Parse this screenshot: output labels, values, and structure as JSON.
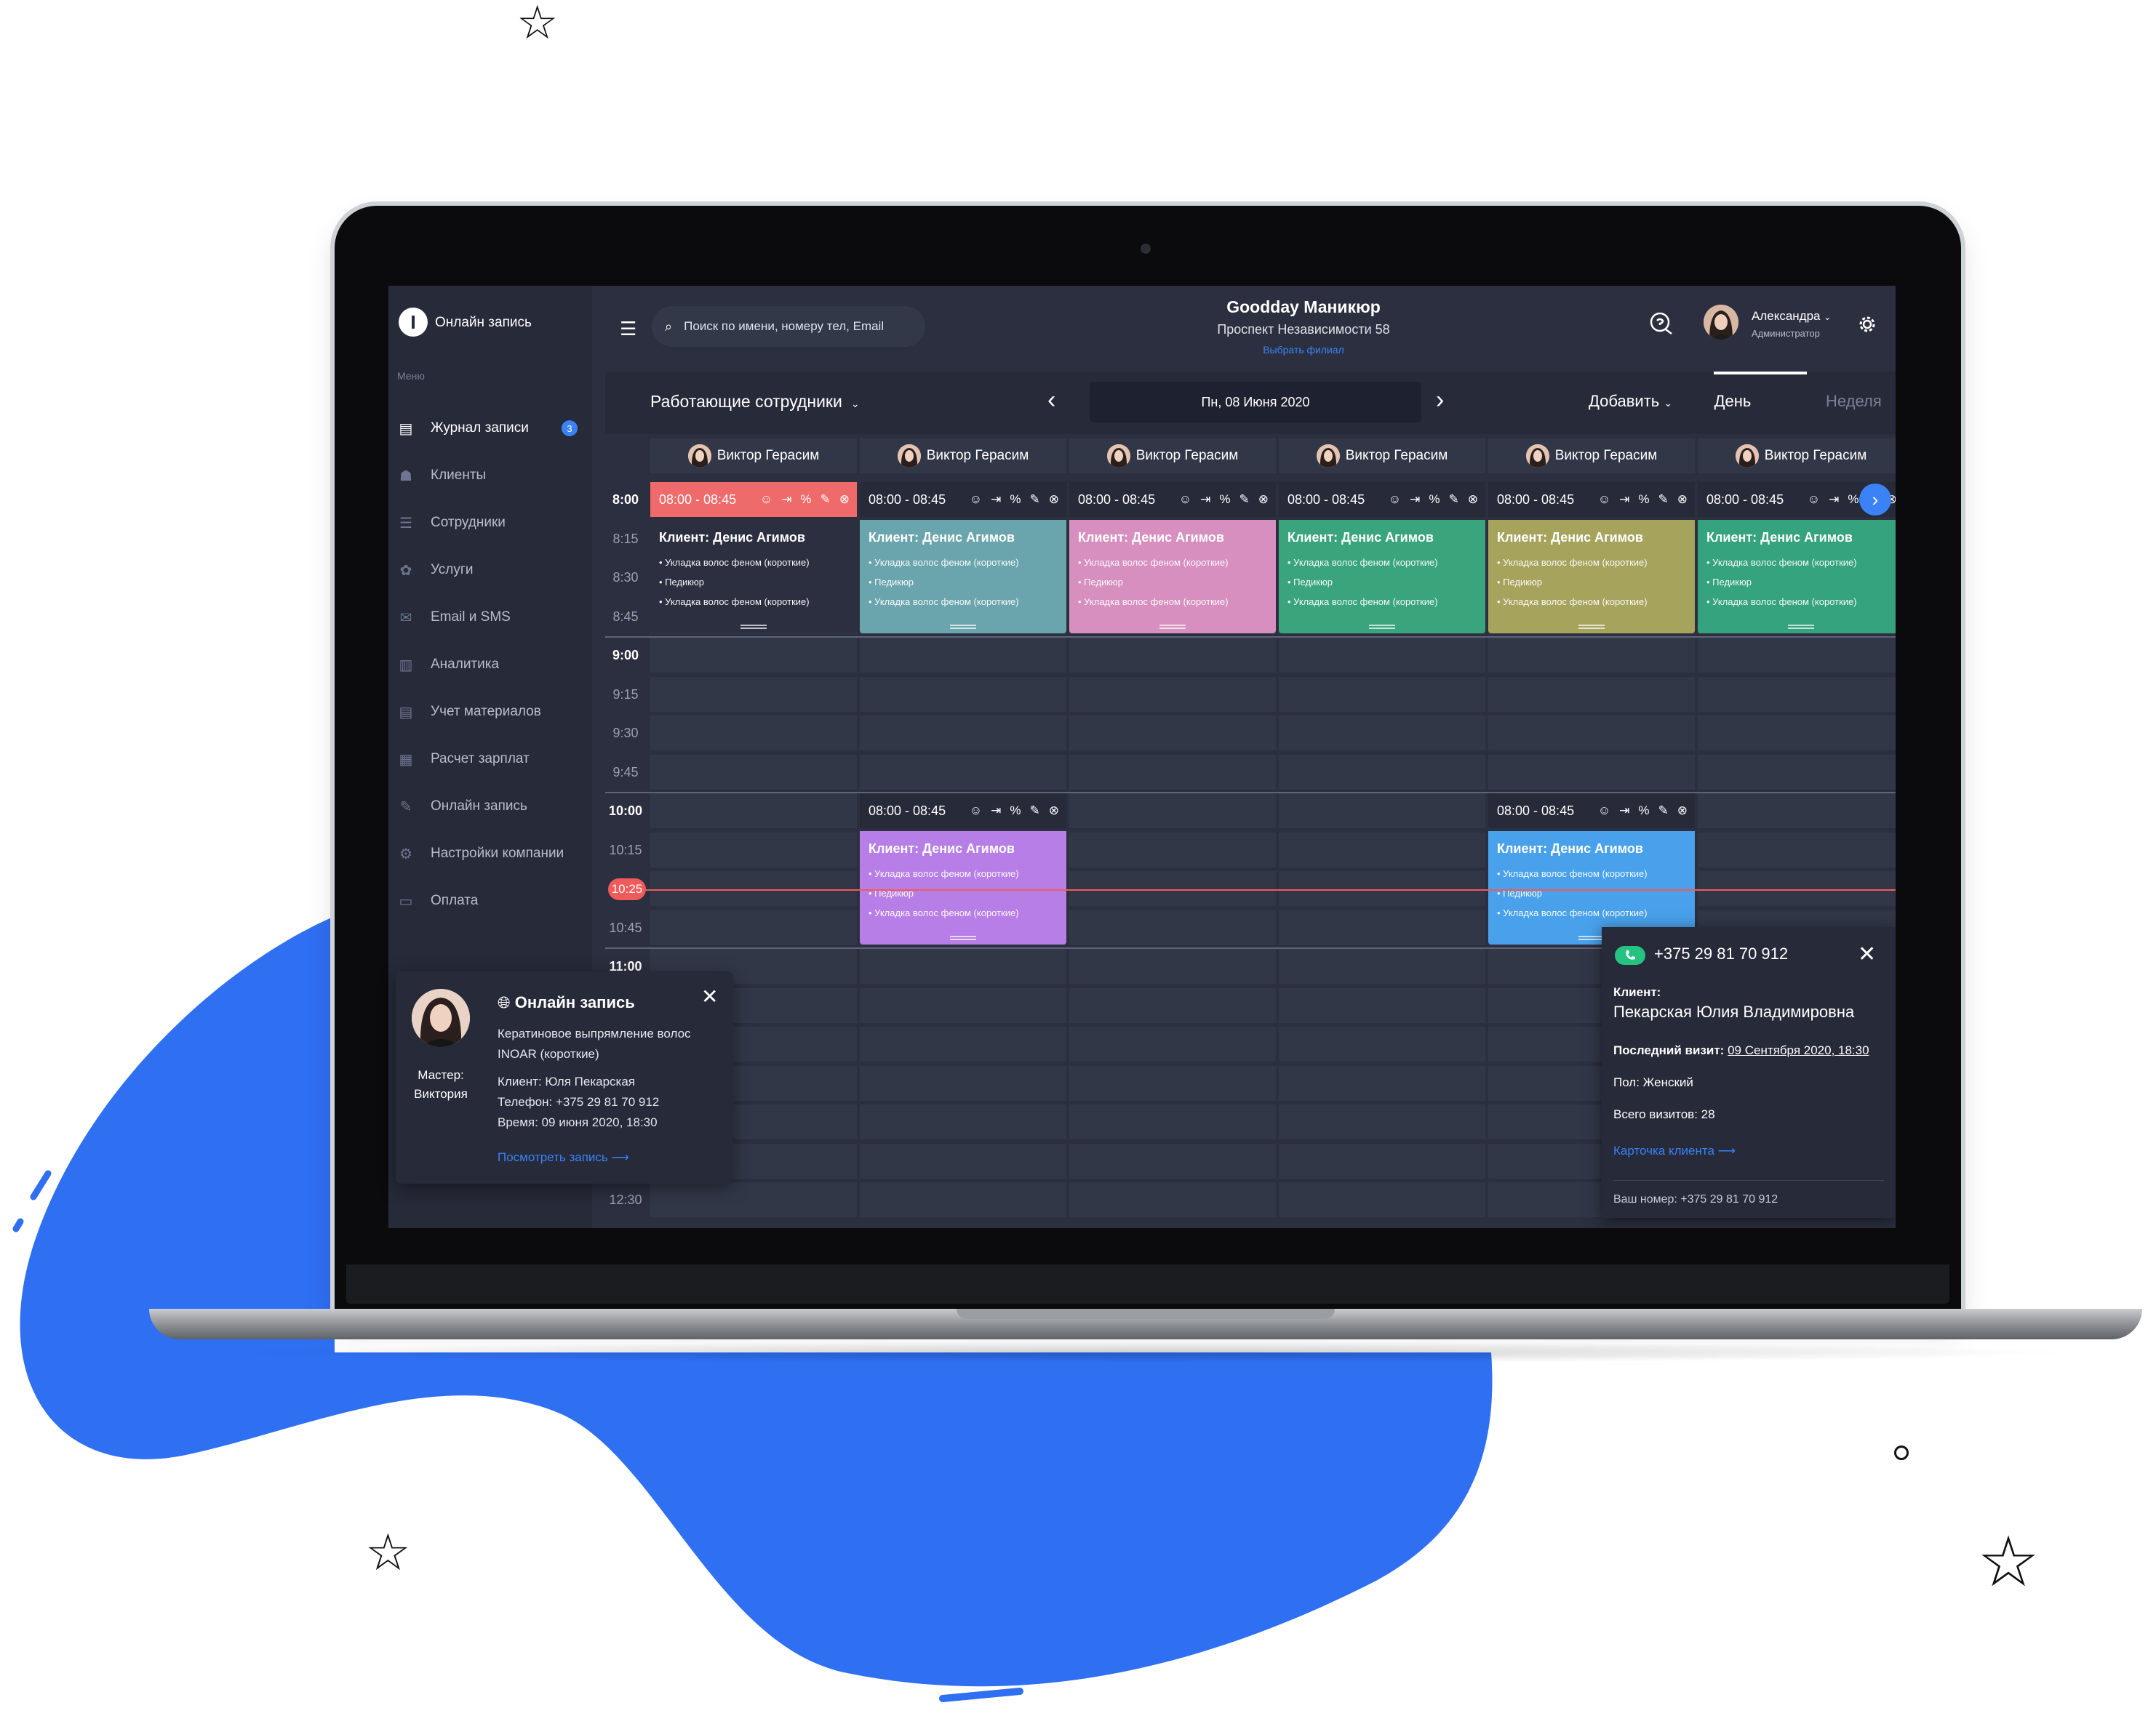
{
  "colors": {
    "accent": "#3b82f6",
    "blob": "#2f6ff2",
    "sidebar": "#262a39",
    "content": "#2b2f3f",
    "slot": "#323748",
    "now": "#ef5b5b",
    "success": "#26c281"
  },
  "app": {
    "logo_text": "Онлайн запись",
    "menu_title": "Меню"
  },
  "sidebar": {
    "items": [
      {
        "label": "Журнал записи",
        "icon": "book-icon",
        "badge": "3"
      },
      {
        "label": "Клиенты",
        "icon": "clients-icon"
      },
      {
        "label": "Сотрудники",
        "icon": "staff-icon"
      },
      {
        "label": "Услуги",
        "icon": "services-icon"
      },
      {
        "label": "Email и SMS",
        "icon": "mail-icon"
      },
      {
        "label": "Аналитика",
        "icon": "chart-icon"
      },
      {
        "label": "Учет материалов",
        "icon": "materials-icon"
      },
      {
        "label": "Расчет зарплат",
        "icon": "salary-icon"
      },
      {
        "label": "Онлайн запись",
        "icon": "online-booking-icon"
      },
      {
        "label": "Настройки компании",
        "icon": "gear-icon"
      },
      {
        "label": "Оплата",
        "icon": "payment-icon"
      }
    ]
  },
  "header": {
    "search_placeholder": "Поиск по имени, номеру тел, Email",
    "title": "Goodday Маникюр",
    "address": "Проспект Независимости 58",
    "branch_link": "Выбрать филиал",
    "user_name": "Александра",
    "user_role": "Администратор"
  },
  "toolbar": {
    "filter": "Работающие сотрудники",
    "date": "Пн, 08 Июня 2020",
    "add": "Добавить",
    "view_day": "День",
    "view_week": "Неделя"
  },
  "staff": [
    "Виктор Герасим",
    "Виктор Герасим",
    "Виктор Герасим",
    "Виктор Герасим",
    "Виктор Герасим",
    "Виктор Герасим"
  ],
  "times": [
    {
      "label": "8:00",
      "hour": true
    },
    {
      "label": "8:15"
    },
    {
      "label": "8:30"
    },
    {
      "label": "8:45"
    },
    {
      "label": "9:00",
      "hour": true
    },
    {
      "label": "9:15"
    },
    {
      "label": "9:30"
    },
    {
      "label": "9:45"
    },
    {
      "label": "10:00",
      "hour": true
    },
    {
      "label": "10:15"
    },
    {
      "label": ""
    },
    {
      "label": "10:45"
    },
    {
      "label": "11:00",
      "hour": true
    },
    {
      "label": ""
    },
    {
      "label": ""
    },
    {
      "label": ""
    },
    {
      "label": ""
    },
    {
      "label": ""
    },
    {
      "label": "12:30"
    }
  ],
  "current_time": "10:25",
  "appointment": {
    "time": "08:00 - 08:45",
    "client": "Клиент: Денис Агимов",
    "services": [
      "• Укладка волос феном (короткие)",
      "• Педикюр",
      "• Укладка волос феном (короткие)"
    ]
  },
  "appointments": [
    {
      "col": 0,
      "row": 0,
      "color": "#6f9fd8",
      "head_color": "#ef6a6a",
      "body_color": "#2b2f3f"
    },
    {
      "col": 1,
      "row": 0,
      "color": "#6aa4ad"
    },
    {
      "col": 2,
      "row": 0,
      "color": "#d68fbf"
    },
    {
      "col": 3,
      "row": 0,
      "color": "#3aa57c"
    },
    {
      "col": 4,
      "row": 0,
      "color": "#a6a35c"
    },
    {
      "col": 5,
      "row": 0,
      "color": "#35a37d"
    },
    {
      "col": 1,
      "row": 8,
      "color": "#b67ee6"
    },
    {
      "col": 4,
      "row": 8,
      "color": "#48a1ea"
    }
  ],
  "client_popup": {
    "phone": "+375 29 81 70 912",
    "client_label": "Клиент:",
    "client_name": "Пекарская Юлия Владимировна",
    "last_visit_label": "Последний визит:",
    "last_visit": "09 Сентября 2020, 18:30",
    "gender": "Пол: Женский",
    "visits": "Всего визитов: 28",
    "card_link": "Карточка клиента",
    "your_number": "Ваш номер: +375 29 81 70 912"
  },
  "booking_popup": {
    "title": "Онлайн запись",
    "master_label": "Мастер:",
    "master_name": "Виктория",
    "service": "Кератиновое выпрямление волос INOAR (короткие)",
    "client": "Клиент: Юля Пекарская",
    "phone": "Телефон: +375 29 81 70 912",
    "time": "Время: 09 июня 2020, 18:30",
    "link": "Посмотреть запись"
  }
}
